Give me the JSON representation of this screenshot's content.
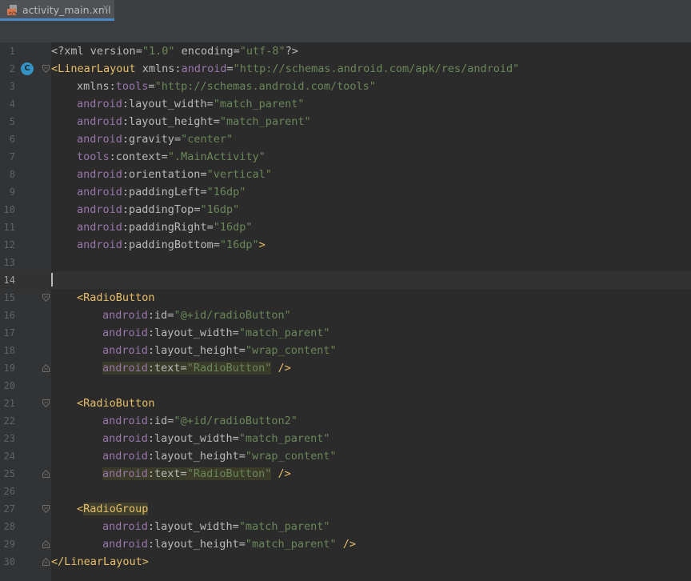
{
  "tab": {
    "label": "activity_main.xml",
    "close": "✕"
  },
  "gutter": {
    "marker_label": "C"
  },
  "editor": {
    "current_line": "14",
    "lines": [
      {
        "n": "1"
      },
      {
        "n": "2"
      },
      {
        "n": "3"
      },
      {
        "n": "4"
      },
      {
        "n": "5"
      },
      {
        "n": "6"
      },
      {
        "n": "7"
      },
      {
        "n": "8"
      },
      {
        "n": "9"
      },
      {
        "n": "10"
      },
      {
        "n": "11"
      },
      {
        "n": "12"
      },
      {
        "n": "13"
      },
      {
        "n": "14"
      },
      {
        "n": "15"
      },
      {
        "n": "16"
      },
      {
        "n": "17"
      },
      {
        "n": "18"
      },
      {
        "n": "19"
      },
      {
        "n": "20"
      },
      {
        "n": "21"
      },
      {
        "n": "22"
      },
      {
        "n": "23"
      },
      {
        "n": "24"
      },
      {
        "n": "25"
      },
      {
        "n": "26"
      },
      {
        "n": "27"
      },
      {
        "n": "28"
      },
      {
        "n": "29"
      },
      {
        "n": "30"
      }
    ],
    "code": {
      "l1": {
        "a": "<?xml ",
        "b": "version",
        "c": "=",
        "d": "\"1.0\"",
        "e": " encoding",
        "f": "=",
        "g": "\"utf-8\"",
        "h": "?>"
      },
      "l2": {
        "a": "<LinearLayout ",
        "b": "xmlns:",
        "c": "android",
        "d": "=",
        "e": "\"http://schemas.android.com/apk/res/android\""
      },
      "l3": {
        "a": "xmlns:",
        "b": "tools",
        "c": "=",
        "d": "\"http://schemas.android.com/tools\""
      },
      "l4": {
        "a": "android",
        "b": ":layout_width",
        "c": "=",
        "d": "\"match_parent\""
      },
      "l5": {
        "a": "android",
        "b": ":layout_height",
        "c": "=",
        "d": "\"match_parent\""
      },
      "l6": {
        "a": "android",
        "b": ":gravity",
        "c": "=",
        "d": "\"center\""
      },
      "l7": {
        "a": "tools",
        "b": ":context",
        "c": "=",
        "d": "\".MainActivity\""
      },
      "l8": {
        "a": "android",
        "b": ":orientation",
        "c": "=",
        "d": "\"vertical\""
      },
      "l9": {
        "a": "android",
        "b": ":paddingLeft",
        "c": "=",
        "d": "\"16dp\""
      },
      "l10": {
        "a": "android",
        "b": ":paddingTop",
        "c": "=",
        "d": "\"16dp\""
      },
      "l11": {
        "a": "android",
        "b": ":paddingRight",
        "c": "=",
        "d": "\"16dp\""
      },
      "l12": {
        "a": "android",
        "b": ":paddingBottom",
        "c": "=",
        "d": "\"16dp\"",
        "e": ">"
      },
      "l15": {
        "a": "<RadioButton"
      },
      "l16": {
        "a": "android",
        "b": ":id",
        "c": "=",
        "d": "\"@+id/radioButton\""
      },
      "l17": {
        "a": "android",
        "b": ":layout_width",
        "c": "=",
        "d": "\"match_parent\""
      },
      "l18": {
        "a": "android",
        "b": ":layout_height",
        "c": "=",
        "d": "\"wrap_content\""
      },
      "l19": {
        "a": "android",
        "b": ":text",
        "c": "=",
        "d": "\"RadioButton\"",
        "e": " />"
      },
      "l21": {
        "a": "<RadioButton"
      },
      "l22": {
        "a": "android",
        "b": ":id",
        "c": "=",
        "d": "\"@+id/radioButton2\""
      },
      "l23": {
        "a": "android",
        "b": ":layout_width",
        "c": "=",
        "d": "\"match_parent\""
      },
      "l24": {
        "a": "android",
        "b": ":layout_height",
        "c": "=",
        "d": "\"wrap_content\""
      },
      "l25": {
        "a": "android",
        "b": ":text",
        "c": "=",
        "d": "\"RadioButton\"",
        "e": " />"
      },
      "l27": {
        "a": "<",
        "b": "RadioGroup"
      },
      "l28": {
        "a": "android",
        "b": ":layout_width",
        "c": "=",
        "d": "\"match_parent\""
      },
      "l29": {
        "a": "android",
        "b": ":layout_height",
        "c": "=",
        "d": "\"match_parent\"",
        "e": " />"
      },
      "l30": {
        "a": "</LinearLayout>"
      }
    }
  }
}
